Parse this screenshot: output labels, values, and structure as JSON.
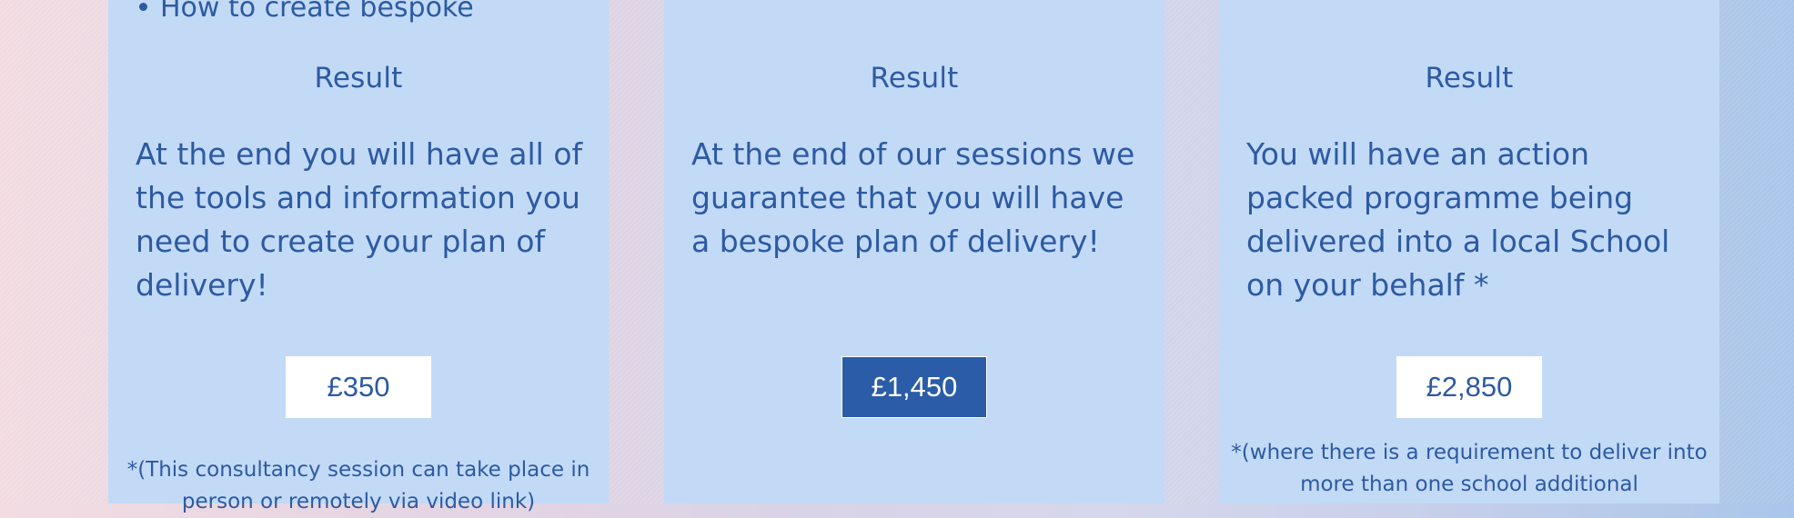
{
  "cards": [
    {
      "bullet": "How to create bespoke",
      "result_heading": "Result",
      "result_text": "At the end you will have all of the tools and information you need to create your plan of delivery!",
      "price": "£350",
      "footnote": "*(This consultancy session can take place in person or remotely via video link)"
    },
    {
      "result_heading": "Result",
      "result_text": "At the end of our sessions we guarantee that you will have a bespoke plan of delivery!",
      "price": "£1,450"
    },
    {
      "result_heading": "Result",
      "result_text": "You will have an action packed programme being delivered into a local School on your behalf *",
      "price": "£2,850",
      "footnote": "*(where there is a requirement to deliver into more than one school additional"
    }
  ],
  "colors": {
    "card_bg": "#c2daf6",
    "text": "#2d5aa2",
    "active_price_bg": "#2b5ca8"
  }
}
